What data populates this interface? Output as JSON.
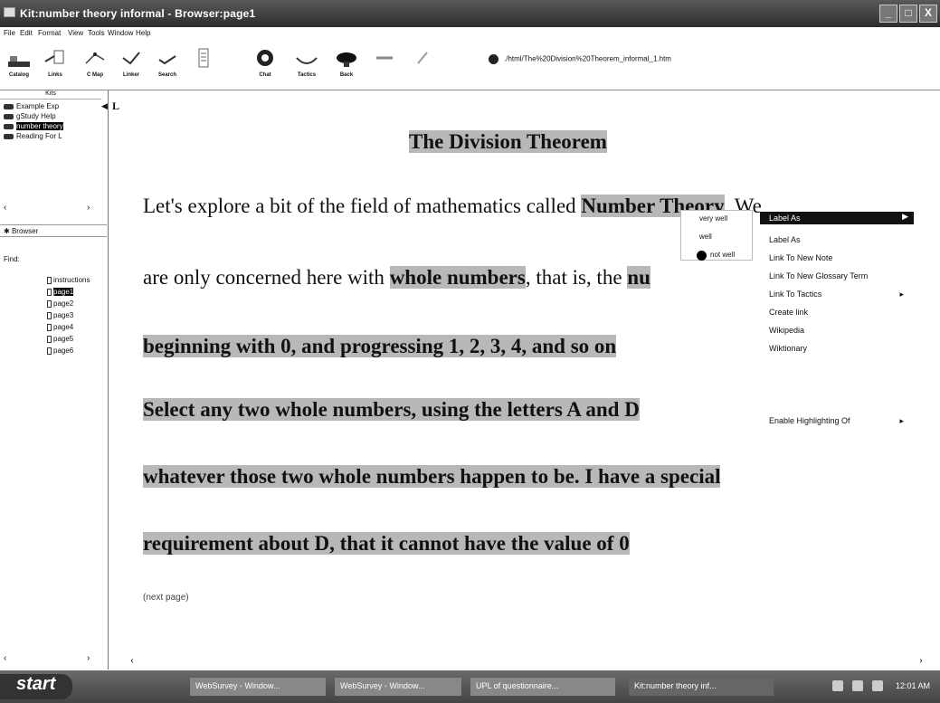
{
  "window": {
    "title": "Kit:number theory informal - Browser:page1",
    "controls": [
      "_",
      "□",
      "X"
    ]
  },
  "menu": [
    "File",
    "Edit",
    "Format",
    "View",
    "Tools",
    "Window",
    "Help"
  ],
  "toolbar": {
    "tools": [
      "Catalog",
      "Links",
      "C Map",
      "Linker",
      "Search",
      "",
      "Chat",
      "Tactics",
      "Back",
      "",
      ""
    ],
    "address": "./html/The%20Division%20Theorem_informal_1.htm"
  },
  "left_panel": {
    "kits_header": "Kits",
    "kits": [
      "Example Exp",
      "gStudy Help",
      "number theory",
      "Reading For L"
    ],
    "selected_kit": 2,
    "browser_header": "Browser",
    "find_label": "Find:",
    "pages": [
      "instructions",
      "page1",
      "page2",
      "page3",
      "page4",
      "page5",
      "page6"
    ],
    "selected_page": 1,
    "marker": "L"
  },
  "content": {
    "heading": "The Division Theorem",
    "line1_pre": "Let's explore a bit of the field of mathematics called ",
    "line1_bold": "Number Theory",
    "line1_post": ". We",
    "line2_pre": "are only concerned here with ",
    "line2_bold": "whole numbers",
    "line2_mid": ", that is, the ",
    "line2_cut": "nu",
    "line3": "beginning with 0, and progressing 1, 2, 3, 4, and so on",
    "line4": "Select any two whole numbers, using the letters A and D",
    "line5": "whatever those two whole numbers happen to be. I have a special",
    "line6": "requirement about D, that it cannot have the value of 0",
    "next_link": "(next page)"
  },
  "label_submenu": [
    "very well",
    "well",
    "not well"
  ],
  "context_menu": {
    "items": [
      "Label As",
      "Label As",
      "Link To New Note",
      "Link To New Glossary Term",
      "Link To Tactics",
      "Create link",
      "Wikipedia",
      "Wiktionary",
      "Enable Highlighting Of"
    ],
    "active_index": 0
  },
  "taskbar": {
    "start": "start",
    "tasks": [
      "WebSurvey - Window...",
      "WebSurvey - Window...",
      "UPL of questionnaire...",
      "Kit:number theory inf..."
    ],
    "clock": "12:01 AM"
  }
}
